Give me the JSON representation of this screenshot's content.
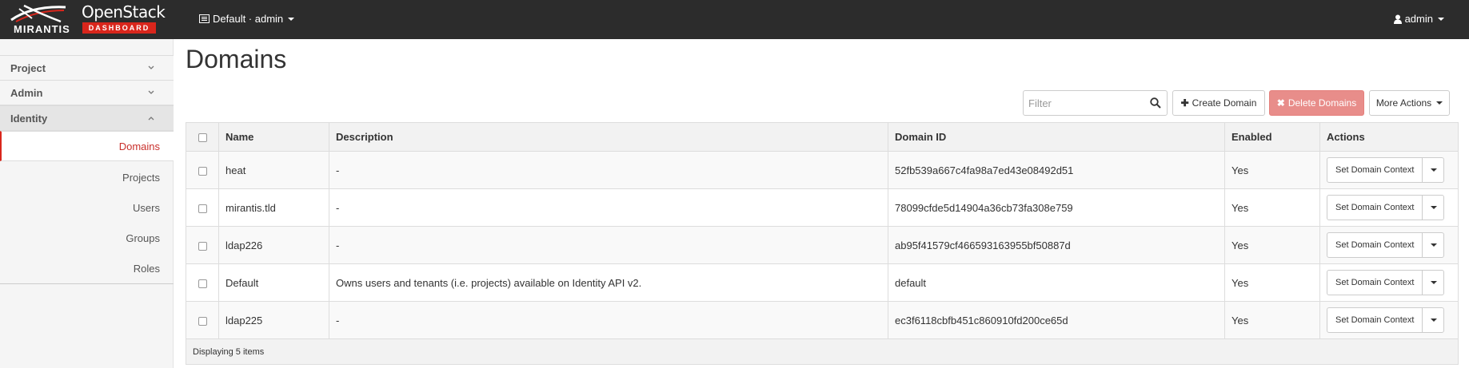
{
  "navbar": {
    "brand_mirantis": "MIRANTIS",
    "brand_openstack": "OpenStack",
    "brand_dashboard": "DASHBOARD",
    "context_label": "Default · admin",
    "user_label": "admin"
  },
  "sidebar": {
    "panels": [
      {
        "label": "Project"
      },
      {
        "label": "Admin"
      },
      {
        "label": "Identity"
      }
    ],
    "items": [
      {
        "label": "Domains"
      },
      {
        "label": "Projects"
      },
      {
        "label": "Users"
      },
      {
        "label": "Groups"
      },
      {
        "label": "Roles"
      }
    ]
  },
  "page": {
    "title": "Domains"
  },
  "toolbar": {
    "filter_placeholder": "Filter",
    "create_label": "Create Domain",
    "delete_label": "Delete Domains",
    "more_label": "More Actions"
  },
  "table": {
    "headers": {
      "name": "Name",
      "description": "Description",
      "domain_id": "Domain ID",
      "enabled": "Enabled",
      "actions": "Actions"
    },
    "rows": [
      {
        "name": "heat",
        "description": "-",
        "domain_id": "52fb539a667c4fa98a7ed43e08492d51",
        "enabled": "Yes",
        "action": "Set Domain Context"
      },
      {
        "name": "mirantis.tld",
        "description": "-",
        "domain_id": "78099cfde5d14904a36cb73fa308e759",
        "enabled": "Yes",
        "action": "Set Domain Context"
      },
      {
        "name": "ldap226",
        "description": "-",
        "domain_id": "ab95f41579cf466593163955bf50887d",
        "enabled": "Yes",
        "action": "Set Domain Context"
      },
      {
        "name": "Default",
        "description": "Owns users and tenants (i.e. projects) available on Identity API v2.",
        "domain_id": "default",
        "enabled": "Yes",
        "action": "Set Domain Context"
      },
      {
        "name": "ldap225",
        "description": "-",
        "domain_id": "ec3f6118cbfb451c860910fd200ce65d",
        "enabled": "Yes",
        "action": "Set Domain Context"
      }
    ],
    "footer": "Displaying 5 items"
  },
  "colors": {
    "navbar_bg": "#2c2c2c",
    "brand_red": "#d9261c",
    "danger_button": "#e88d8a",
    "active_link": "#c9302c"
  }
}
